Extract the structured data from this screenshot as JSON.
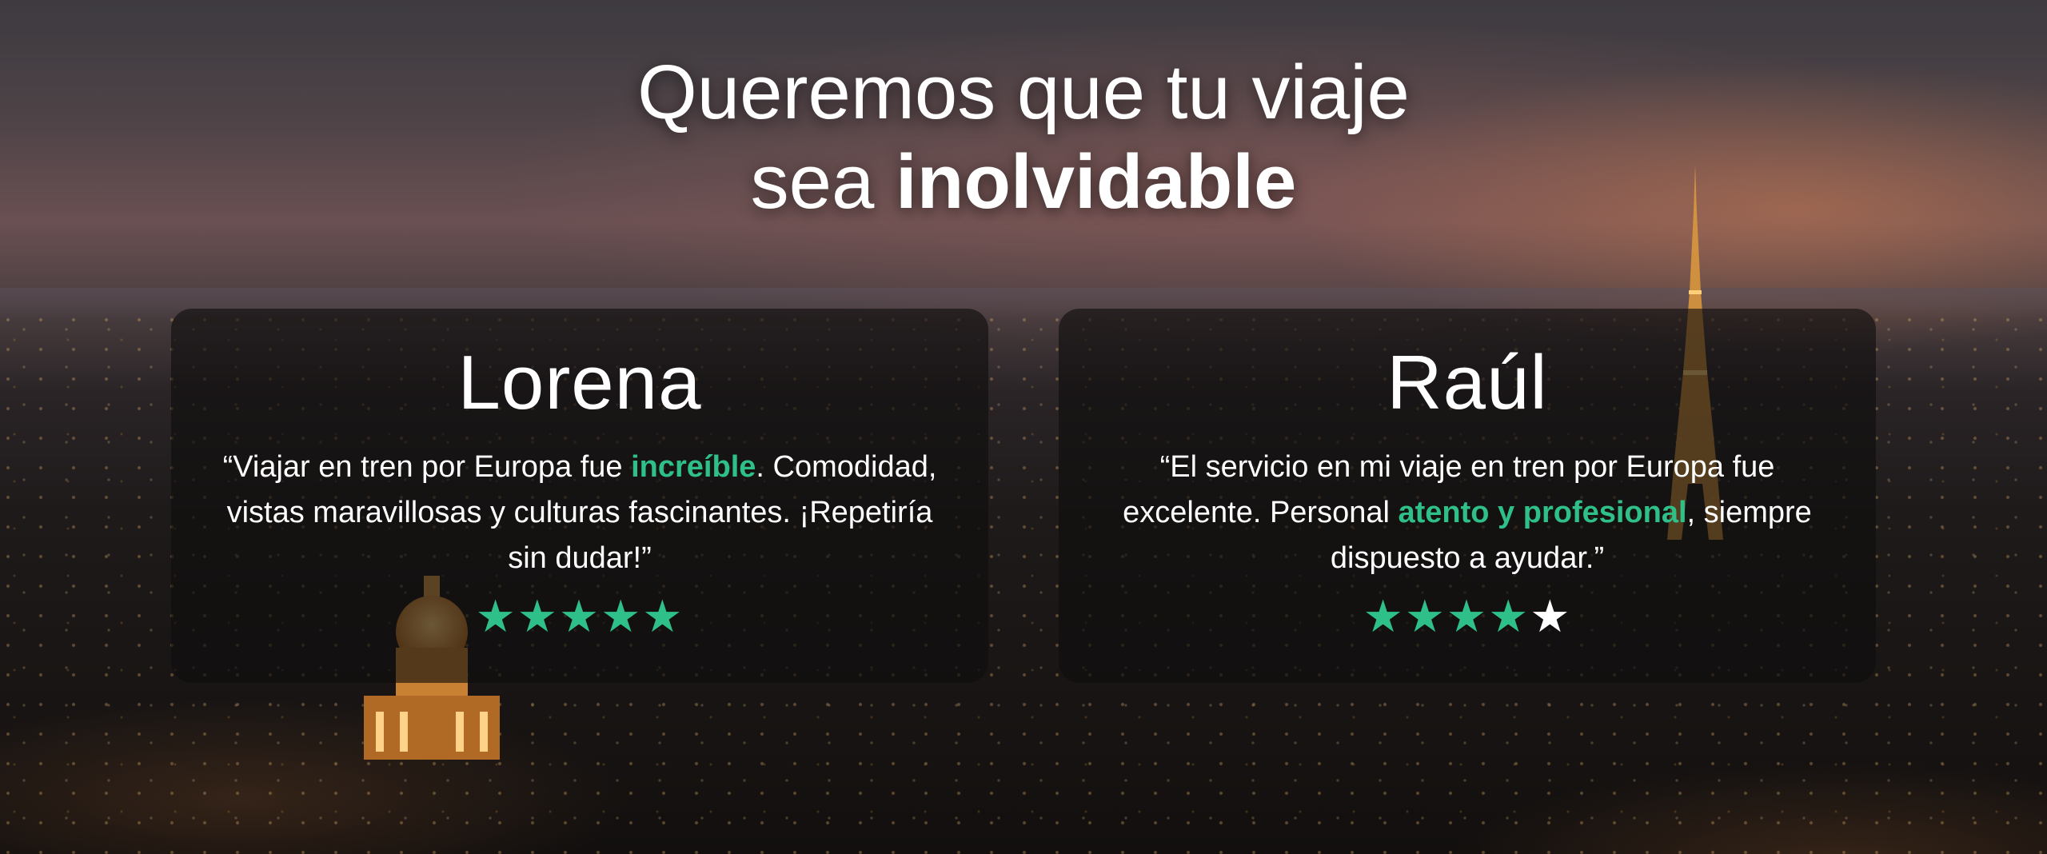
{
  "headline": {
    "line1": "Queremos que tu viaje",
    "line2_prefix": "sea ",
    "line2_bold": "inolvidable"
  },
  "testimonials": [
    {
      "name": "Lorena",
      "quote_parts": [
        "“Viajar en tren por Europa fue ",
        "increíble",
        ". Comodidad, vistas maravillosas y culturas fascinantes. ¡Repetiría sin dudar!”"
      ],
      "rating": 5,
      "rating_max": 5
    },
    {
      "name": "Raúl",
      "quote_parts": [
        "“El servicio en mi viaje en tren por Europa fue excelente. Personal ",
        "atento y profesional",
        ", siempre dispuesto a ayudar.”"
      ],
      "rating": 4,
      "rating_max": 5
    }
  ],
  "icons": {
    "star": "★"
  },
  "colors": {
    "accent": "#2fc08a",
    "text": "#ffffff",
    "card_bg": "rgba(15,13,13,0.62)"
  }
}
